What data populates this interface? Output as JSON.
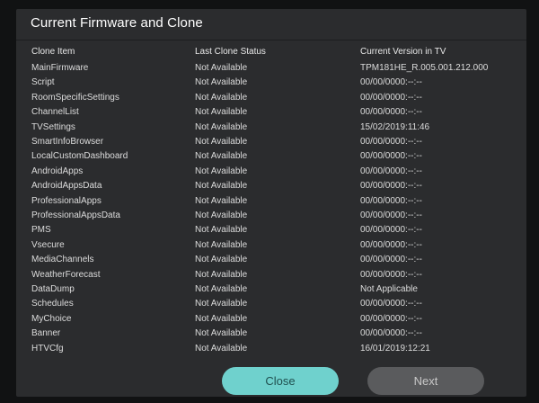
{
  "dialog": {
    "title": "Current Firmware and Clone",
    "columns": [
      "Clone Item",
      "Last Clone Status",
      "Current Version in TV"
    ],
    "rows": [
      {
        "item": "MainFirmware",
        "status": "Not Available",
        "version": "TPM181HE_R.005.001.212.000"
      },
      {
        "item": "Script",
        "status": "Not Available",
        "version": "00/00/0000:--:--"
      },
      {
        "item": "RoomSpecificSettings",
        "status": "Not Available",
        "version": "00/00/0000:--:--"
      },
      {
        "item": "ChannelList",
        "status": "Not Available",
        "version": "00/00/0000:--:--"
      },
      {
        "item": "TVSettings",
        "status": "Not Available",
        "version": "15/02/2019:11:46"
      },
      {
        "item": "SmartInfoBrowser",
        "status": "Not Available",
        "version": "00/00/0000:--:--"
      },
      {
        "item": "LocalCustomDashboard",
        "status": "Not Available",
        "version": "00/00/0000:--:--"
      },
      {
        "item": "AndroidApps",
        "status": "Not Available",
        "version": "00/00/0000:--:--"
      },
      {
        "item": "AndroidAppsData",
        "status": "Not Available",
        "version": "00/00/0000:--:--"
      },
      {
        "item": "ProfessionalApps",
        "status": "Not Available",
        "version": "00/00/0000:--:--"
      },
      {
        "item": "ProfessionalAppsData",
        "status": "Not Available",
        "version": "00/00/0000:--:--"
      },
      {
        "item": "PMS",
        "status": "Not Available",
        "version": "00/00/0000:--:--"
      },
      {
        "item": "Vsecure",
        "status": "Not Available",
        "version": "00/00/0000:--:--"
      },
      {
        "item": "MediaChannels",
        "status": "Not Available",
        "version": "00/00/0000:--:--"
      },
      {
        "item": "WeatherForecast",
        "status": "Not Available",
        "version": "00/00/0000:--:--"
      },
      {
        "item": "DataDump",
        "status": "Not Available",
        "version": "Not Applicable"
      },
      {
        "item": "Schedules",
        "status": "Not Available",
        "version": "00/00/0000:--:--"
      },
      {
        "item": "MyChoice",
        "status": "Not Available",
        "version": "00/00/0000:--:--"
      },
      {
        "item": "Banner",
        "status": "Not Available",
        "version": "00/00/0000:--:--"
      },
      {
        "item": "HTVCfg",
        "status": "Not Available",
        "version": "16/01/2019:12:21"
      }
    ]
  },
  "buttons": {
    "close_label": "Close",
    "next_label": "Next"
  },
  "colors": {
    "dialog_bg": "#2b2c2e",
    "close_bg": "#6fd1cd",
    "next_bg": "#5a5b5d"
  }
}
